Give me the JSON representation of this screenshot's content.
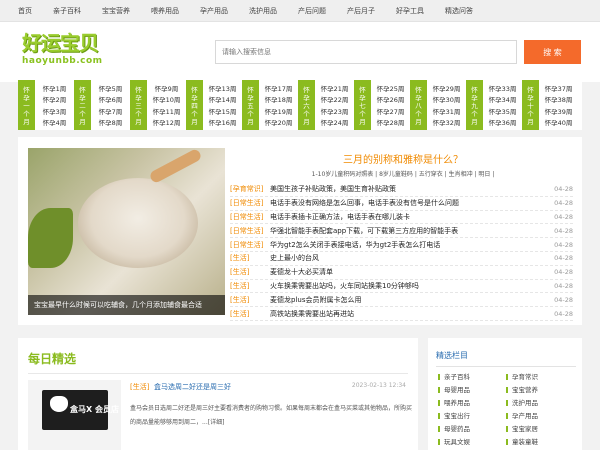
{
  "nav": [
    "首页",
    "亲子百科",
    "宝宝营养",
    "喂养用品",
    "孕产用品",
    "洗护用品",
    "产后问题",
    "产后月子",
    "好孕工具",
    "精选问答"
  ],
  "header": {
    "logo_cn": "好运宝贝",
    "logo_en": "haoyunbb.com",
    "search_placeholder": "请输入搜索信息",
    "search_button": "搜 索"
  },
  "weeks": [
    {
      "label": [
        "怀",
        "孕",
        "一",
        "个",
        "月"
      ],
      "items": [
        "怀孕1周",
        "怀孕2周",
        "怀孕3周",
        "怀孕4周"
      ]
    },
    {
      "label": [
        "怀",
        "孕",
        "二",
        "个",
        "月"
      ],
      "items": [
        "怀孕5周",
        "怀孕6周",
        "怀孕7周",
        "怀孕8周"
      ]
    },
    {
      "label": [
        "怀",
        "孕",
        "三",
        "个",
        "月"
      ],
      "items": [
        "怀孕9周",
        "怀孕10周",
        "怀孕11周",
        "怀孕12周"
      ]
    },
    {
      "label": [
        "怀",
        "孕",
        "四",
        "个",
        "月"
      ],
      "items": [
        "怀孕13周",
        "怀孕14周",
        "怀孕15周",
        "怀孕16周"
      ]
    },
    {
      "label": [
        "怀",
        "孕",
        "五",
        "个",
        "月"
      ],
      "items": [
        "怀孕17周",
        "怀孕18周",
        "怀孕19周",
        "怀孕20周"
      ]
    },
    {
      "label": [
        "怀",
        "孕",
        "六",
        "个",
        "月"
      ],
      "items": [
        "怀孕21周",
        "怀孕22周",
        "怀孕23周",
        "怀孕24周"
      ]
    },
    {
      "label": [
        "怀",
        "孕",
        "七",
        "个",
        "月"
      ],
      "items": [
        "怀孕25周",
        "怀孕26周",
        "怀孕27周",
        "怀孕28周"
      ]
    },
    {
      "label": [
        "怀",
        "孕",
        "八",
        "个",
        "月"
      ],
      "items": [
        "怀孕29周",
        "怀孕30周",
        "怀孕31周",
        "怀孕32周"
      ]
    },
    {
      "label": [
        "怀",
        "孕",
        "九",
        "个",
        "月"
      ],
      "items": [
        "怀孕33周",
        "怀孕34周",
        "怀孕35周",
        "怀孕36周"
      ]
    },
    {
      "label": [
        "怀",
        "孕",
        "十",
        "个",
        "月"
      ],
      "items": [
        "怀孕37周",
        "怀孕38周",
        "怀孕39周",
        "怀孕40周"
      ]
    }
  ],
  "feature": {
    "caption": "宝宝最早什么时候可以吃辅食，几个月添加辅食最合适",
    "headline": "三月的别称和雅称是什么？",
    "subline": "1-10岁儿童积码对照表 | 8岁儿童鞋码 | 五行穿衣 | 生肖相冲 | 明日 |"
  },
  "news": [
    {
      "cat": "[孕育常识]",
      "title": "美国生孩子补贴政策，美国生育补贴政策",
      "date": "04-28"
    },
    {
      "cat": "[日常生活]",
      "title": "电话手表没有网络是怎么回事，电话手表没有信号是什么问题",
      "date": "04-28"
    },
    {
      "cat": "[日常生活]",
      "title": "电话手表插卡正确方法，电话手表在哪儿装卡",
      "date": "04-28"
    },
    {
      "cat": "[日常生活]",
      "title": "华强北智能手表配套app下载，可下载第三方应用的智能手表",
      "date": "04-28"
    },
    {
      "cat": "[日常生活]",
      "title": "华为gt2怎么关闭手表接电话，华为gt2手表怎么打电话",
      "date": "04-28"
    },
    {
      "cat": "[生活]",
      "title": "史上最小的台风",
      "date": "04-28"
    },
    {
      "cat": "[生活]",
      "title": "麦德龙十大必买清单",
      "date": "04-28"
    },
    {
      "cat": "[生活]",
      "title": "火车换乘需要出站吗，火车同站换乘10分钟够吗",
      "date": "04-28"
    },
    {
      "cat": "[生活]",
      "title": "麦德龙plus会员附属卡怎么用",
      "date": "04-28"
    },
    {
      "cat": "[生活]",
      "title": "高铁站换乘需要出站再进站",
      "date": "04-28"
    }
  ],
  "daily": {
    "heading": "每日精选",
    "thumb_text": "盒马X 会员店",
    "cat": "[生活]",
    "title": "盒马选周二好还是周三好",
    "date": "2023-02-13 12:34",
    "summary": "盒马会员日选周二好还是周三好主要看消费者的购物习惯。如果每周末都会在盒马买菜或其他物品，所购买的商品量能够够用到周二，...[详细]"
  },
  "side": {
    "heading": "精选栏目",
    "items": [
      "亲子百科",
      "孕育常识",
      "母婴用品",
      "宝宝营养",
      "喂养用品",
      "洗护用品",
      "宝宝出行",
      "孕产用品",
      "母婴药品",
      "宝宝家居",
      "玩具文娱",
      "童装童鞋"
    ]
  },
  "colors": {
    "accent_green": "#8bbb1f",
    "accent_orange": "#f08a00",
    "search_button": "#f46a2b",
    "link_blue": "#2a6db0"
  }
}
